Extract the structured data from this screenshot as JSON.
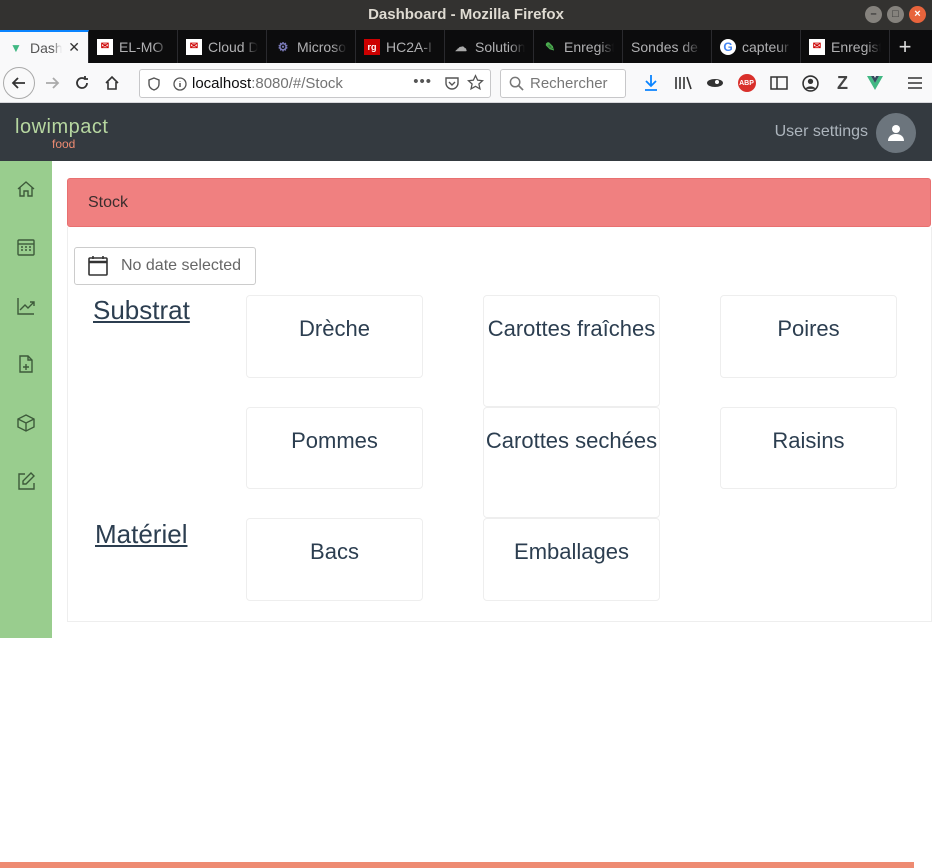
{
  "window": {
    "title": "Dashboard - Mozilla Firefox"
  },
  "tabs": [
    {
      "label": "Dashboard",
      "icon": "vue-icon",
      "active": true
    },
    {
      "label": "EL-MO",
      "icon": "mail-icon"
    },
    {
      "label": "Cloud D",
      "icon": "mail-icon"
    },
    {
      "label": "Microsoft",
      "icon": "gear-icon"
    },
    {
      "label": "HC2A-I",
      "icon": "rg-icon"
    },
    {
      "label": "Solution",
      "icon": "cloud-icon"
    },
    {
      "label": "Enregistre",
      "icon": "pen-icon"
    },
    {
      "label": "Sondes de",
      "icon": ""
    },
    {
      "label": "capteur",
      "icon": "google-icon"
    },
    {
      "label": "Enregist",
      "icon": "mail-icon"
    }
  ],
  "navbar": {
    "url_host": "localhost",
    "url_path": ":8080/#/Stock",
    "search_placeholder": "Rechercher"
  },
  "app": {
    "logo_main": "lowimpact",
    "logo_sub": "food",
    "user_settings": "User settings"
  },
  "sidebar": {
    "items": [
      "home-icon",
      "calendar-icon",
      "chart-icon",
      "file-add-icon",
      "box-icon",
      "edit-icon"
    ]
  },
  "page": {
    "breadcrumb": "Stock",
    "date_label": "No date selected",
    "sections": [
      {
        "title": "Substrat",
        "items": [
          "Drèche",
          "Carottes fraîches",
          "Poires",
          "Pommes",
          "Carottes sechées",
          "Raisins"
        ]
      },
      {
        "title": "Matériel",
        "items": [
          "Bacs",
          "Emballages"
        ]
      }
    ]
  },
  "colors": {
    "header": "#343a40",
    "sidebar": "#99cd8e",
    "stock_bar": "#f08080",
    "accent": "#ee8b72"
  }
}
